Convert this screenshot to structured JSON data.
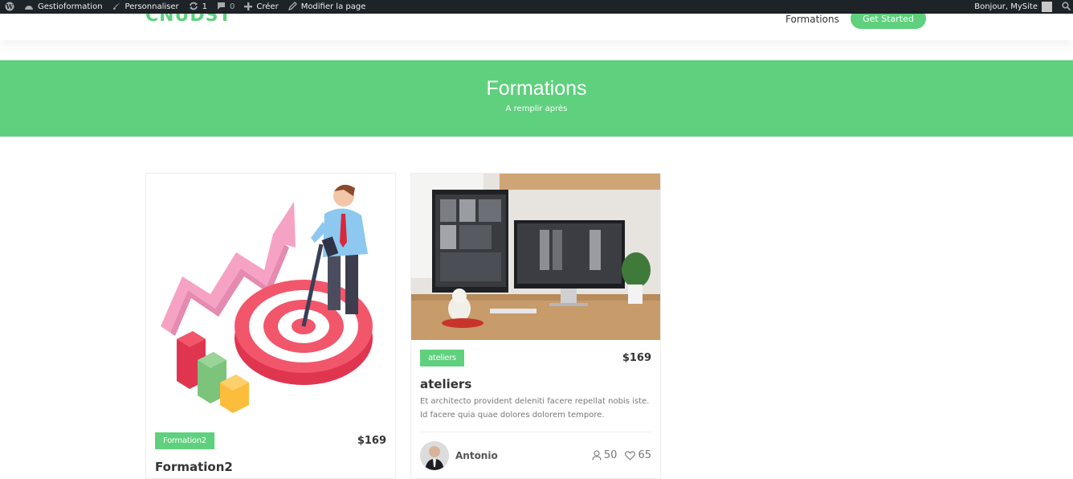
{
  "adminbar": {
    "site_name": "Gestioformation",
    "customize": "Personnaliser",
    "updates_count": "1",
    "comments_count": "0",
    "create": "Créer",
    "edit_page": "Modifier la page",
    "greeting": "Bonjour, MySite"
  },
  "header": {
    "logo": "CNUDST",
    "nav_formations": "Formations",
    "cta": "Get Started",
    "accent_color": "#5fd07d"
  },
  "hero": {
    "title": "Formations",
    "subtitle": "A remplir après"
  },
  "courses": [
    {
      "tag": "Formation2",
      "price": "$169",
      "title": "Formation2",
      "image": "target-growth-illustration"
    },
    {
      "tag": "ateliers",
      "price": "$169",
      "title": "ateliers",
      "description": "Et architecto provident deleniti facere repellat nobis iste. Id facere quia quae dolores dolorem tempore.",
      "instructor": "Antonio",
      "students": "50",
      "likes": "65",
      "image": "desk-monitors-photo"
    }
  ]
}
